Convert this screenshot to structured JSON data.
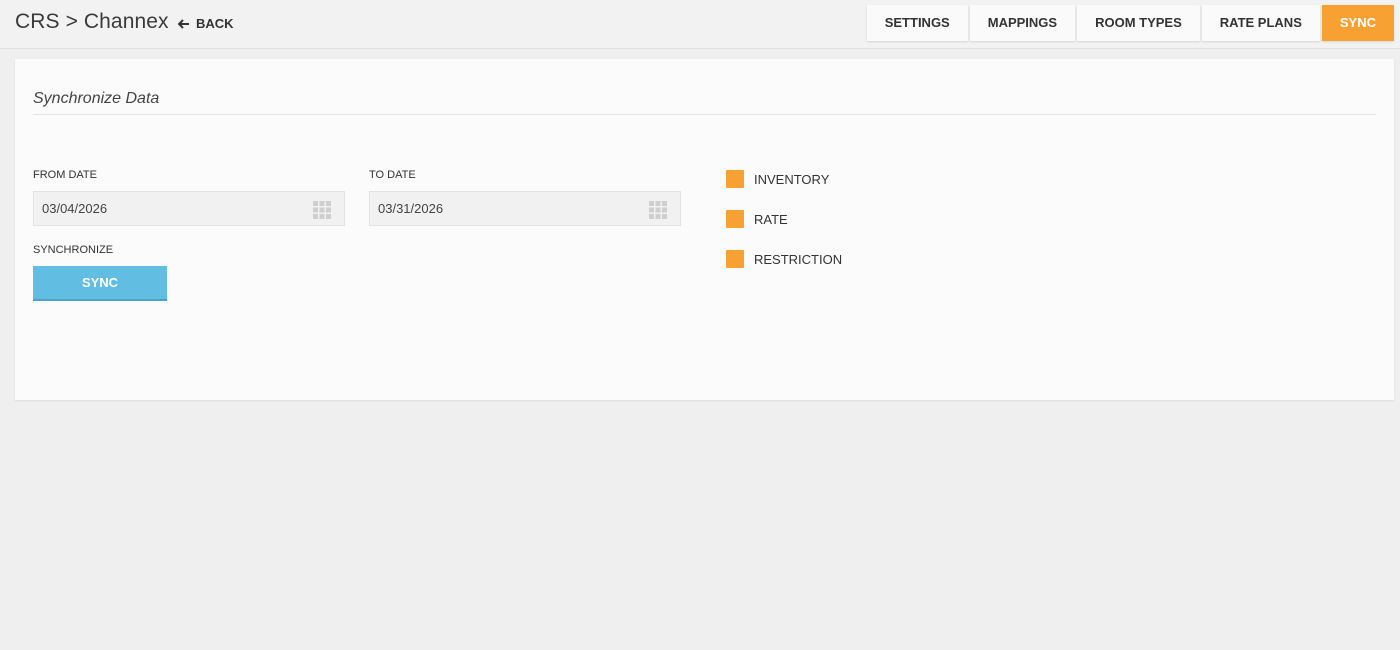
{
  "header": {
    "breadcrumb": "CRS > Channex",
    "back_label": "BACK"
  },
  "tabs": [
    {
      "label": "SETTINGS",
      "active": false
    },
    {
      "label": "MAPPINGS",
      "active": false
    },
    {
      "label": "ROOM TYPES",
      "active": false
    },
    {
      "label": "RATE PLANS",
      "active": false
    },
    {
      "label": "SYNC",
      "active": true
    }
  ],
  "panel": {
    "title": "Synchronize Data",
    "from_date": {
      "label": "FROM DATE",
      "value": "03/04/2026",
      "icon": "calendar-icon"
    },
    "to_date": {
      "label": "TO DATE",
      "value": "03/31/2026",
      "icon": "calendar-icon"
    },
    "synchronize_label": "SYNCHRONIZE",
    "sync_button": "SYNC",
    "options": [
      {
        "label": "INVENTORY",
        "checked": true
      },
      {
        "label": "RATE",
        "checked": true
      },
      {
        "label": "RESTRICTION",
        "checked": true
      }
    ]
  },
  "colors": {
    "accent": "#f7a133",
    "button": "#62bde2",
    "background": "#efefef",
    "panel": "#fbfbfb"
  }
}
